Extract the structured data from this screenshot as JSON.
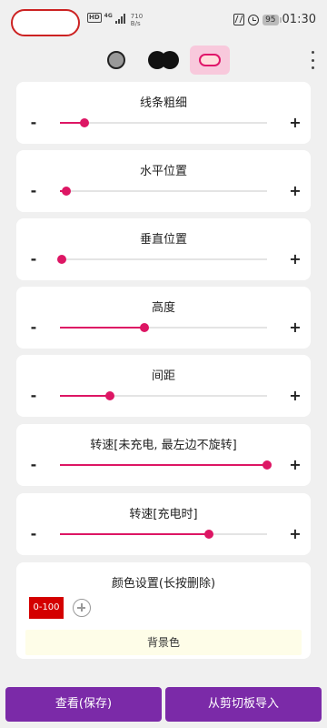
{
  "status_bar": {
    "net_type": "4G",
    "hd": "HD",
    "speed_value": "710",
    "speed_unit": "B/s",
    "battery": "95",
    "time": "01:30",
    "icons": [
      "nfc-icon",
      "alarm-icon",
      "battery-icon",
      "signal-icon"
    ]
  },
  "mode_bar": {
    "modes": [
      "single-dot-mode",
      "double-dot-mode",
      "pill-mode"
    ],
    "selected": "pill-mode"
  },
  "sliders": [
    {
      "label": "线条粗细",
      "minus": "-",
      "plus": "+",
      "value_fraction": 0.12
    },
    {
      "label": "水平位置",
      "minus": "-",
      "plus": "+",
      "value_fraction": 0.03
    },
    {
      "label": "垂直位置",
      "minus": "-",
      "plus": "+",
      "value_fraction": 0.01
    },
    {
      "label": "高度",
      "minus": "-",
      "plus": "+",
      "value_fraction": 0.41
    },
    {
      "label": "间距",
      "minus": "-",
      "plus": "+",
      "value_fraction": 0.24
    },
    {
      "label": "转速[未充电, 最左边不旋转]",
      "minus": "-",
      "plus": "+",
      "value_fraction": 1.0
    },
    {
      "label": "转速[充电时]",
      "minus": "-",
      "plus": "+",
      "value_fraction": 0.72
    }
  ],
  "colors": {
    "title": "颜色设置(长按删除)",
    "chip_label": "0-100",
    "chip_color": "#d40000",
    "background_button": "背景色",
    "accent": "#dd1664"
  },
  "bottom": {
    "view_save": "查看(保存)",
    "import_clipboard": "从剪切板导入",
    "button_color": "#7b2aa8"
  }
}
